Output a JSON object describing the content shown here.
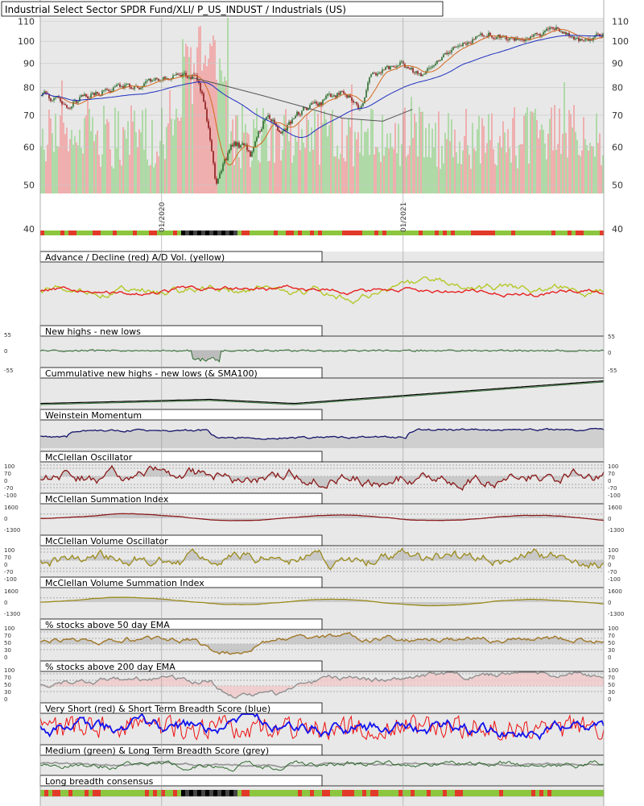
{
  "chart_data": {
    "type": "line",
    "title": "Industrial Select Sector SPDR Fund/XLI/ P_US_INDUST / Industrials (US)",
    "x_range": [
      "2019-07",
      "2021-11"
    ],
    "date_labels": [
      {
        "label": "01/2020",
        "date": "2020-01-01"
      },
      {
        "label": "01/2021",
        "date": "2021-01-01"
      }
    ],
    "colors": {
      "price_up": "#2b6b2b",
      "price_down": "#8b1a1a",
      "sma_short": "#d2691e",
      "sma_long": "#1e2fbf",
      "sma_mid": "#555555",
      "vol_up": "#a8d8a0",
      "vol_down": "#f0a8a8",
      "ad_line": "#e82020",
      "ad_vol": "#b4c828",
      "nhnl": "#2e6b2e",
      "weinstein": "#15156b",
      "mcclellan": "#8b1a1a",
      "mcclellan_vol": "#9b8a1a",
      "ema50": "#a07828",
      "ema200": "#909090",
      "very_short": "#ee1111",
      "short": "#1212ee",
      "medium": "#2e6b2e",
      "long": "#999999"
    },
    "price_panel": {
      "log_scale": true,
      "ylim": [
        48,
        112
      ],
      "y_ticks": [
        110,
        100,
        90,
        80,
        70,
        60,
        50
      ],
      "extra_tick": 40,
      "close_keypoints": [
        [
          "2019-07-01",
          78
        ],
        [
          "2019-08-10",
          73
        ],
        [
          "2019-09-20",
          78
        ],
        [
          "2019-11-01",
          80
        ],
        [
          "2019-12-15",
          82
        ],
        [
          "2020-01-20",
          84
        ],
        [
          "2020-02-20",
          85
        ],
        [
          "2020-03-05",
          75
        ],
        [
          "2020-03-23",
          50
        ],
        [
          "2020-04-20",
          62
        ],
        [
          "2020-05-15",
          58
        ],
        [
          "2020-06-08",
          70
        ],
        [
          "2020-06-30",
          64
        ],
        [
          "2020-08-01",
          72
        ],
        [
          "2020-09-01",
          75
        ],
        [
          "2020-10-01",
          78
        ],
        [
          "2020-10-30",
          72
        ],
        [
          "2020-11-10",
          84
        ],
        [
          "2020-12-31",
          90
        ],
        [
          "2021-01-29",
          84
        ],
        [
          "2021-03-15",
          96
        ],
        [
          "2021-05-10",
          104
        ],
        [
          "2021-06-20",
          100
        ],
        [
          "2021-07-30",
          103
        ],
        [
          "2021-08-20",
          107
        ],
        [
          "2021-09-20",
          100
        ],
        [
          "2021-10-31",
          103
        ]
      ],
      "sma_mid_keypoints": [
        [
          "2020-02-15",
          84
        ],
        [
          "2020-04-01",
          81
        ],
        [
          "2020-06-01",
          77
        ],
        [
          "2020-08-01",
          73
        ],
        [
          "2020-10-01",
          69
        ],
        [
          "2020-12-01",
          68
        ],
        [
          "2021-01-15",
          72
        ]
      ]
    },
    "panels": [
      {
        "name": "Advance / Decline (red) A/D Vol. (yellow)",
        "series": [
          "A/D",
          "A/D Vol."
        ]
      },
      {
        "name": "New highs - new lows",
        "y_ticks": [
          55,
          0,
          -55
        ]
      },
      {
        "name": "Cummulative new highs - new lows (& SMA100)"
      },
      {
        "name": "Weinstein Momentum"
      },
      {
        "name": "McClellan Oscillator",
        "y_ticks": [
          100,
          70,
          0,
          -70,
          -100
        ]
      },
      {
        "name": "McClellan Summation Index",
        "y_ticks": [
          1600,
          0,
          -1300
        ]
      },
      {
        "name": "McClellan Volume Oscillator",
        "y_ticks": [
          100,
          70,
          0,
          -70,
          -100
        ]
      },
      {
        "name": "McClellan Volume Summation Index",
        "y_ticks": [
          1600,
          0,
          -1300
        ]
      },
      {
        "name": "% stocks above 50 day EMA",
        "y_ticks": [
          100,
          70,
          50,
          30,
          0
        ]
      },
      {
        "name": "% stocks above 200 day EMA",
        "y_ticks": [
          100,
          70,
          50,
          30,
          0
        ]
      },
      {
        "name": "Very Short (red) & Short Term Breadth Score (blue)"
      },
      {
        "name": "Medium (green) & Long Term Breadth Score (grey)"
      },
      {
        "name": "Long breadth consensus"
      }
    ]
  }
}
